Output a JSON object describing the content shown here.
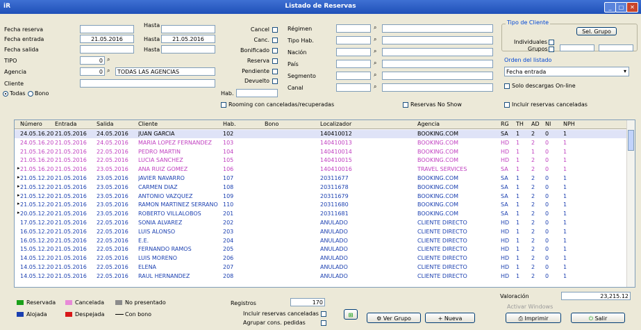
{
  "window": {
    "title": "Listado de Reservas",
    "icon_text": "iR"
  },
  "left": {
    "fecha_reserva_label": "Fecha reserva",
    "fecha_entrada_label": "Fecha entrada",
    "fecha_entrada_from": "21.05.2016",
    "hasta_label": "Hasta",
    "fecha_entrada_to": "21.05.2016",
    "fecha_salida_label": "Fecha salida",
    "tipo_label": "TIPO",
    "tipo_value": "0",
    "agencia_label": "Agencia",
    "agencia_value": "0",
    "agencia_name": "TODAS LAS AGENCIAS",
    "cliente_label": "Cliente",
    "radio_todas": "Todas",
    "radio_bono": "Bono"
  },
  "middle": {
    "checks": [
      "Cancel",
      "Canc.",
      "Bonificado",
      "Reserva",
      "Pendiente",
      "Devuelto"
    ],
    "hab_label": "Hab."
  },
  "right_fields": [
    "Régimen",
    "Tipo Hab.",
    "Nación",
    "País",
    "Segmento",
    "Canal"
  ],
  "options": {
    "group_title": "Tipo de Cliente",
    "individuales_label": "Individuales",
    "grupos_label": "Grupos",
    "sel_grupo_button": "Sel. Grupo",
    "orden_title": "Orden del listado",
    "orden_value": "Fecha entrada",
    "solo_descargas": "Solo descargas On-line",
    "incluir_label": "Incluir reservas canceladas",
    "no_show_label": "Reservas No Show",
    "rooming_label": "Rooming con canceladas/recuperadas"
  },
  "grid": {
    "headers": [
      "Número",
      "Entrada",
      "Salida",
      "Cliente",
      "Hab.",
      "Bono",
      "Localizador",
      "Agencia",
      "RG",
      "TH",
      "AD",
      "NI",
      "NPH"
    ],
    "rows": [
      [
        "24.05.16.2016",
        "21.05.2016",
        "24.05.2016",
        "JUAN GARCIA",
        "102",
        "",
        "140410012",
        "BOOKING.COM",
        "SA",
        "1",
        "2",
        "0",
        "1"
      ],
      [
        "24.05.16.2016",
        "21.05.2016",
        "24.05.2016",
        "MARIA LOPEZ FERNANDEZ",
        "103",
        "",
        "140410013",
        "BOOKING.COM",
        "HD",
        "1",
        "2",
        "0",
        "1"
      ],
      [
        "21.05.16.2016",
        "21.05.2016",
        "22.05.2016",
        "PEDRO MARTIN",
        "104",
        "",
        "140410014",
        "BOOKING.COM",
        "HD",
        "1",
        "1",
        "0",
        "1"
      ],
      [
        "21.05.16.2016",
        "21.05.2016",
        "22.05.2016",
        "LUCIA SANCHEZ",
        "105",
        "",
        "140410015",
        "BOOKING.COM",
        "HD",
        "1",
        "2",
        "0",
        "1"
      ],
      [
        "21.05.16.2016",
        "21.05.2016",
        "23.05.2016",
        "ANA RUIZ GOMEZ",
        "106",
        "",
        "140410016",
        "TRAVEL SERVICES",
        "SA",
        "1",
        "2",
        "0",
        "1"
      ],
      [
        "21.05.12.2016",
        "21.05.2016",
        "23.05.2016",
        "JAVIER NAVARRO",
        "107",
        "",
        "20311677",
        "BOOKING.COM",
        "SA",
        "1",
        "2",
        "0",
        "1"
      ],
      [
        "21.05.12.2016",
        "21.05.2016",
        "23.05.2016",
        "CARMEN DIAZ",
        "108",
        "",
        "20311678",
        "BOOKING.COM",
        "SA",
        "1",
        "2",
        "0",
        "1"
      ],
      [
        "21.05.12.2016",
        "21.05.2016",
        "23.05.2016",
        "ANTONIO VAZQUEZ",
        "109",
        "",
        "20311679",
        "BOOKING.COM",
        "SA",
        "1",
        "2",
        "0",
        "1"
      ],
      [
        "21.05.12.2016",
        "21.05.2016",
        "23.05.2016",
        "RAMON MARTINEZ SERRANO",
        "110",
        "",
        "20311680",
        "BOOKING.COM",
        "SA",
        "1",
        "2",
        "0",
        "1"
      ],
      [
        "20.05.12.2016",
        "21.05.2016",
        "23.05.2016",
        "ROBERTO VILLALOBOS",
        "201",
        "",
        "20311681",
        "BOOKING.COM",
        "SA",
        "1",
        "2",
        "0",
        "1"
      ],
      [
        "17.05.12.2016",
        "21.05.2016",
        "22.05.2016",
        "SONIA ALVAREZ",
        "202",
        "",
        "ANULADO",
        "CLIENTE DIRECTO",
        "HD",
        "1",
        "2",
        "0",
        "1"
      ],
      [
        "16.05.12.2016",
        "21.05.2016",
        "22.05.2016",
        "LUIS ALONSO",
        "203",
        "",
        "ANULADO",
        "CLIENTE DIRECTO",
        "HD",
        "1",
        "2",
        "0",
        "1"
      ],
      [
        "16.05.12.2016",
        "21.05.2016",
        "22.05.2016",
        "E.E.",
        "204",
        "",
        "ANULADO",
        "CLIENTE DIRECTO",
        "HD",
        "1",
        "2",
        "0",
        "1"
      ],
      [
        "15.05.12.2016",
        "21.05.2016",
        "22.05.2016",
        "FERNANDO RAMOS",
        "205",
        "",
        "ANULADO",
        "CLIENTE DIRECTO",
        "HD",
        "1",
        "2",
        "0",
        "1"
      ],
      [
        "14.05.12.2016",
        "21.05.2016",
        "22.05.2016",
        "LUIS MORENO",
        "206",
        "",
        "ANULADO",
        "CLIENTE DIRECTO",
        "HD",
        "1",
        "2",
        "0",
        "1"
      ],
      [
        "14.05.12.2016",
        "21.05.2016",
        "22.05.2016",
        "ELENA",
        "207",
        "",
        "ANULADO",
        "CLIENTE DIRECTO",
        "HD",
        "1",
        "2",
        "0",
        "1"
      ],
      [
        "14.05.12.2016",
        "21.05.2016",
        "22.05.2016",
        "RAUL HERNANDEZ",
        "208",
        "",
        "ANULADO",
        "CLIENTE DIRECTO",
        "HD",
        "1",
        "2",
        "0",
        "1"
      ]
    ]
  },
  "footer": {
    "legend": [
      {
        "label": "Reservada",
        "color": "#1aa01a"
      },
      {
        "label": "Cancelada",
        "color": "#e88ad8"
      },
      {
        "label": "No presentado",
        "color": "#8c8c8c"
      },
      {
        "label": "Alojada",
        "color": "#1a3fb0"
      },
      {
        "label": "Despejada",
        "color": "#d81818"
      },
      {
        "label": "Con bono",
        "color": "#000000"
      }
    ],
    "registros_label": "Registros",
    "registros_value": "170",
    "agrupar_label": "Incluir reservas canceladas",
    "grupos_label": "Agrupar cons. pedidas",
    "totales_label": "Valoración",
    "totales_value": "23,215.12",
    "btn_ver_grupo": "Ver Grupo",
    "btn_nueva": "Nueva",
    "btn_imprimir": "Imprimir",
    "btn_salir": "Salir",
    "activate_text": "Activar Windows"
  },
  "colors": {
    "pink_text": "#c040c0",
    "blue_text": "#1a3fb0",
    "selected_row": "#dfe3f7"
  }
}
